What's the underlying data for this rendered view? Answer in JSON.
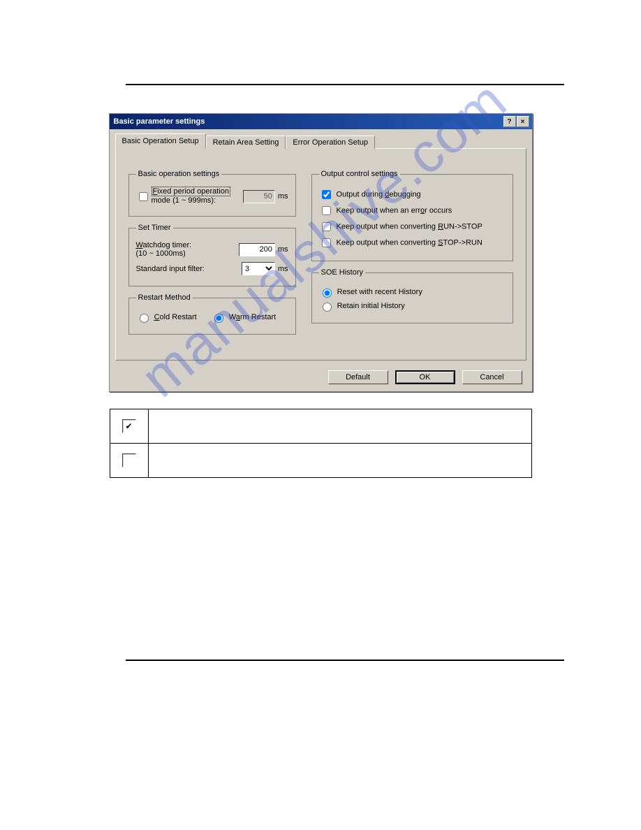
{
  "dialog": {
    "title": "Basic parameter settings"
  },
  "tabs": {
    "t0": "Basic Operation Setup",
    "t1": "Retain Area Setting",
    "t2": "Error Operation Setup"
  },
  "basic_op": {
    "legend": "Basic operation settings",
    "fixed_label": "Fixed period operation mode (1 ~ 999ms):",
    "fixed_checked": false,
    "fixed_value": "50",
    "fixed_unit": "ms"
  },
  "timer": {
    "legend": "Set Timer",
    "watchdog_label": "Watchdog timer: (10 ~ 1000ms)",
    "watchdog_value": "200",
    "unit": "ms",
    "stdfilter_label": "Standard input filter:",
    "stdfilter_value": "3"
  },
  "restart": {
    "legend": "Restart Method",
    "cold": "Cold Restart",
    "warm": "Warm Restart",
    "selected": "warm"
  },
  "output": {
    "legend": "Output control settings",
    "debug": "Output during debugging",
    "debug_checked": true,
    "keep_error": "Keep output when an error occurs",
    "keep_run_stop": "Keep output when converting RUN->STOP",
    "keep_stop_run": "Keep output when converting STOP->RUN"
  },
  "soe": {
    "legend": "SOE History",
    "reset": "Reset with recent History",
    "retain": "Retain initial History",
    "selected": "reset"
  },
  "buttons": {
    "default": "Default",
    "ok": "OK",
    "cancel": "Cancel"
  },
  "watermark": "manualshive.com"
}
